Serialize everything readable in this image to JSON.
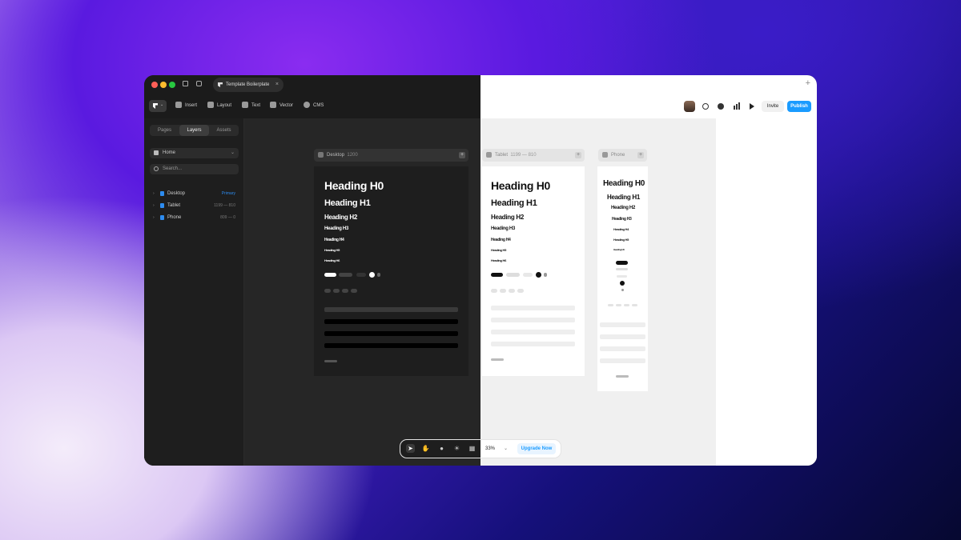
{
  "tab": {
    "title": "Template Boilerplate",
    "close": "×"
  },
  "toolbar": {
    "insert": "Insert",
    "layout": "Layout",
    "text": "Text",
    "vector": "Vector",
    "cms": "CMS",
    "invite": "Invite",
    "publish": "Publish",
    "new_tab": "+"
  },
  "sidebar": {
    "tabs": [
      "Pages",
      "Layers",
      "Assets"
    ],
    "page_select": "Home",
    "search_placeholder": "Search...",
    "layers": [
      {
        "label": "Desktop",
        "meta": "Primary"
      },
      {
        "label": "Tablet",
        "meta": "1199 — 810"
      },
      {
        "label": "Phone",
        "meta": "809 — 0"
      }
    ]
  },
  "frames": {
    "desktop": {
      "label": "Desktop",
      "size": "1200"
    },
    "tablet": {
      "label": "Tablet",
      "size": "1199 — 810"
    },
    "phone": {
      "label": "Phone",
      "size": ""
    }
  },
  "headings": [
    "Heading H0",
    "Heading H1",
    "Heading H2",
    "Heading H3",
    "Heading H4",
    "Heading H5",
    "Heading H6"
  ],
  "bottom": {
    "zoom": "33%",
    "upgrade": "Upgrade Now"
  },
  "colors": {
    "accent": "#1a9bff",
    "primary_meta": "#2d8cf0",
    "dark_bg": "#1b1b1b",
    "canvas_dark": "#262626",
    "canvas_light": "#f0f0f0"
  }
}
